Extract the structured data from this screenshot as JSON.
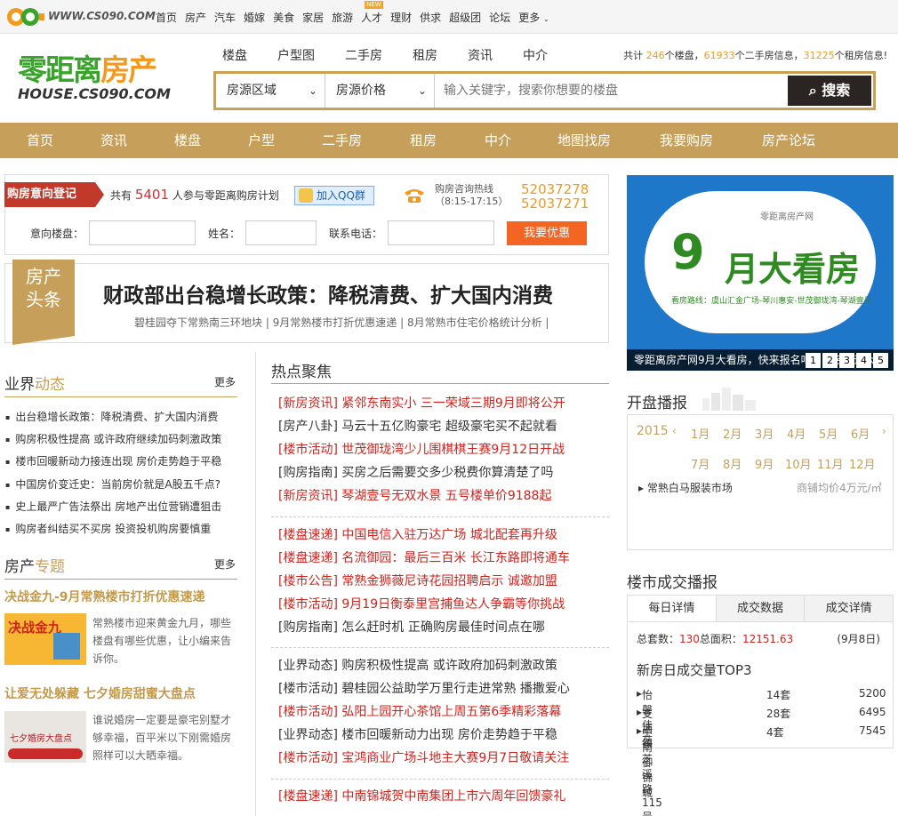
{
  "top": {
    "site": "WWW.CS090.COM",
    "nav": [
      "首页",
      "房产",
      "汽车",
      "婚嫁",
      "美食",
      "家居",
      "旅游",
      "人才",
      "理财",
      "供求",
      "超级团",
      "论坛",
      "更多"
    ],
    "new_badge": "NEW"
  },
  "logo": {
    "line1_green": "零距离",
    "line1_orange": "房产",
    "line2": "HOUSE.CS090.COM"
  },
  "subnav": [
    "楼盘",
    "户型图",
    "二手房",
    "租房",
    "资讯",
    "中介"
  ],
  "stats": {
    "p1": "共计 ",
    "n1": "246",
    "p2": "个楼盘，",
    "n2": "61933",
    "p3": "个二手房信息，",
    "n3": "31225",
    "p4": "个租房信息!"
  },
  "search": {
    "select1": "房源区域",
    "select2": "房源价格",
    "placeholder": "输入关键字，搜索你想要的楼盘",
    "button": "搜索"
  },
  "mainnav": [
    "首页",
    "资讯",
    "楼盘",
    "户型",
    "二手房",
    "租房",
    "中介",
    "地图找房",
    "我要购房",
    "房产论坛"
  ],
  "register": {
    "tag": "购房意向登记",
    "count_pre": "共有 ",
    "count": "5401",
    "count_post": " 人参与零距离购房计划",
    "qq": "加入QQ群",
    "hotline_label": "购房咨询热线",
    "hotline_hours": "（8:15-17:15）",
    "phone1": "52037278",
    "phone2": "52037271",
    "f1": "意向楼盘：",
    "f2": "姓名：",
    "f3": "联系电话：",
    "btn": "我要优惠"
  },
  "headline": {
    "tag1": "房产",
    "tag2": "头条",
    "title": "财政部出台稳增长政策：降税清费、扩大国内消费",
    "sub": "碧桂园夺下常熟南三环地块 | 9月常熟楼市打折优惠速递 | 8月常熟市住宅价格统计分析 |"
  },
  "banner": {
    "small": "零距离房产网",
    "big1": "9",
    "big2": "月大看房",
    "route": "看房路线：虞山汇金广场-琴川惠安-世茂御珑湾-琴湖壹号",
    "caption": "零距离房产网9月大看房，快来报名吧，数名欢迎大家",
    "nums": [
      "1",
      "2",
      "3",
      "4",
      "5"
    ]
  },
  "industry": {
    "title1": "业界",
    "title2": "动态",
    "more": "更多",
    "items": [
      "出台稳增长政策：降税清费、扩大国内消费",
      "购房积极性提高 或许政府继续加码刺激政策",
      "楼市回暖新动力接连出现 房价走势趋于平稳",
      "中国房价变迁史：当前房价就是A股五千点?",
      "史上最严广告法祭出 房地产出位营销遭狙击",
      "购房者纠结买不买房 投资投机购房要慎重"
    ]
  },
  "topics": {
    "title1": "房产",
    "title2": "专题",
    "more": "更多",
    "t1": "决战金九-9月常熟楼市打折优惠速递",
    "d1": "常熟楼市迎来黄金九月，哪些楼盘有哪些优惠，让小编来告诉你。",
    "thumb1": "决战金九",
    "t2": "让爱无处躲藏 七夕婚房甜蜜大盘点",
    "d2": "谁说婚房一定要是豪宅别墅才够幸福，百平米以下刚需婚房照样可以大晒幸福。",
    "thumb2": "七夕婚房大盘点"
  },
  "hot": {
    "title": "热点聚焦",
    "g1": [
      {
        "tag": "[新房资讯]",
        "text": "紧邻东南实小 三一荣域三期9月即将公开",
        "red": true
      },
      {
        "tag": "[房产八卦]",
        "text": "马云十五亿购豪宅 超级豪宅买不起就看",
        "red": false
      },
      {
        "tag": "[楼市活动]",
        "text": "世茂御珑湾少儿围棋棋王赛9月12日开战",
        "red": true
      },
      {
        "tag": "[购房指南]",
        "text": "买房之后需要交多少税费你算清楚了吗",
        "red": false
      },
      {
        "tag": "[新房资讯]",
        "text": "琴湖壹号无双水景 五号楼单价9188起",
        "red": true
      }
    ],
    "g2": [
      {
        "tag": "[楼盘速递]",
        "text": "中国电信入驻万达广场 城北配套再升级",
        "red": true
      },
      {
        "tag": "[楼盘速递]",
        "text": "名流御园：最后三百米 长江东路即将通车",
        "red": true
      },
      {
        "tag": "[楼市公告]",
        "text": "常熟金狮薇尼诗花园招聘启示 诚邀加盟",
        "red": true
      },
      {
        "tag": "[楼市活动]",
        "text": "9月19日衡泰里宫捕鱼达人争霸等你挑战",
        "red": true
      },
      {
        "tag": "[购房指南]",
        "text": "怎么赶时机 正确购房最佳时间点在哪",
        "red": false
      }
    ],
    "g3": [
      {
        "tag": "[业界动态]",
        "text": "购房积极性提高 或许政府加码刺激政策",
        "red": false
      },
      {
        "tag": "[楼市活动]",
        "text": "碧桂园公益助学万里行走进常熟 播撒爱心",
        "red": false
      },
      {
        "tag": "[楼市活动]",
        "text": "弘阳上园开心茶馆上周五第6季精彩落幕",
        "red": true
      },
      {
        "tag": "[业界动态]",
        "text": "楼市回暖新动力出现 房价走势趋于平稳",
        "red": false
      },
      {
        "tag": "[楼市活动]",
        "text": "宝鸿商业广场斗地主大赛9月7日敬请关注",
        "red": true
      }
    ],
    "g4": [
      {
        "tag": "[楼盘速递]",
        "text": "中南锦城贺中南集团上市六周年回馈豪礼",
        "red": true
      }
    ]
  },
  "kaipan": {
    "title": "开盘播报",
    "year": "2015",
    "months": [
      "1月",
      "2月",
      "3月",
      "4月",
      "5月",
      "6月",
      "7月",
      "8月",
      "9月",
      "10月",
      "11月",
      "12月"
    ],
    "item": "常熟白马服装市场",
    "price": "商铺均价4万元/㎡"
  },
  "deals": {
    "title": "楼市成交播报",
    "tabs": [
      "每日详情",
      "成交数据",
      "成交详情"
    ],
    "sum_pre": "总套数：",
    "sum": "130",
    "area_pre": "总面积：",
    "area": "12151.63",
    "date": "(9月8日)",
    "top3": "新房日成交量TOP3",
    "rows": [
      {
        "name": "怡馨佳苑",
        "count": "14套",
        "price": "5200"
      },
      {
        "name": "支塘镇芝溪路115号",
        "count": "28套",
        "price": "6495"
      },
      {
        "name": "中南御锦城",
        "count": "4套",
        "price": "7545"
      }
    ]
  }
}
